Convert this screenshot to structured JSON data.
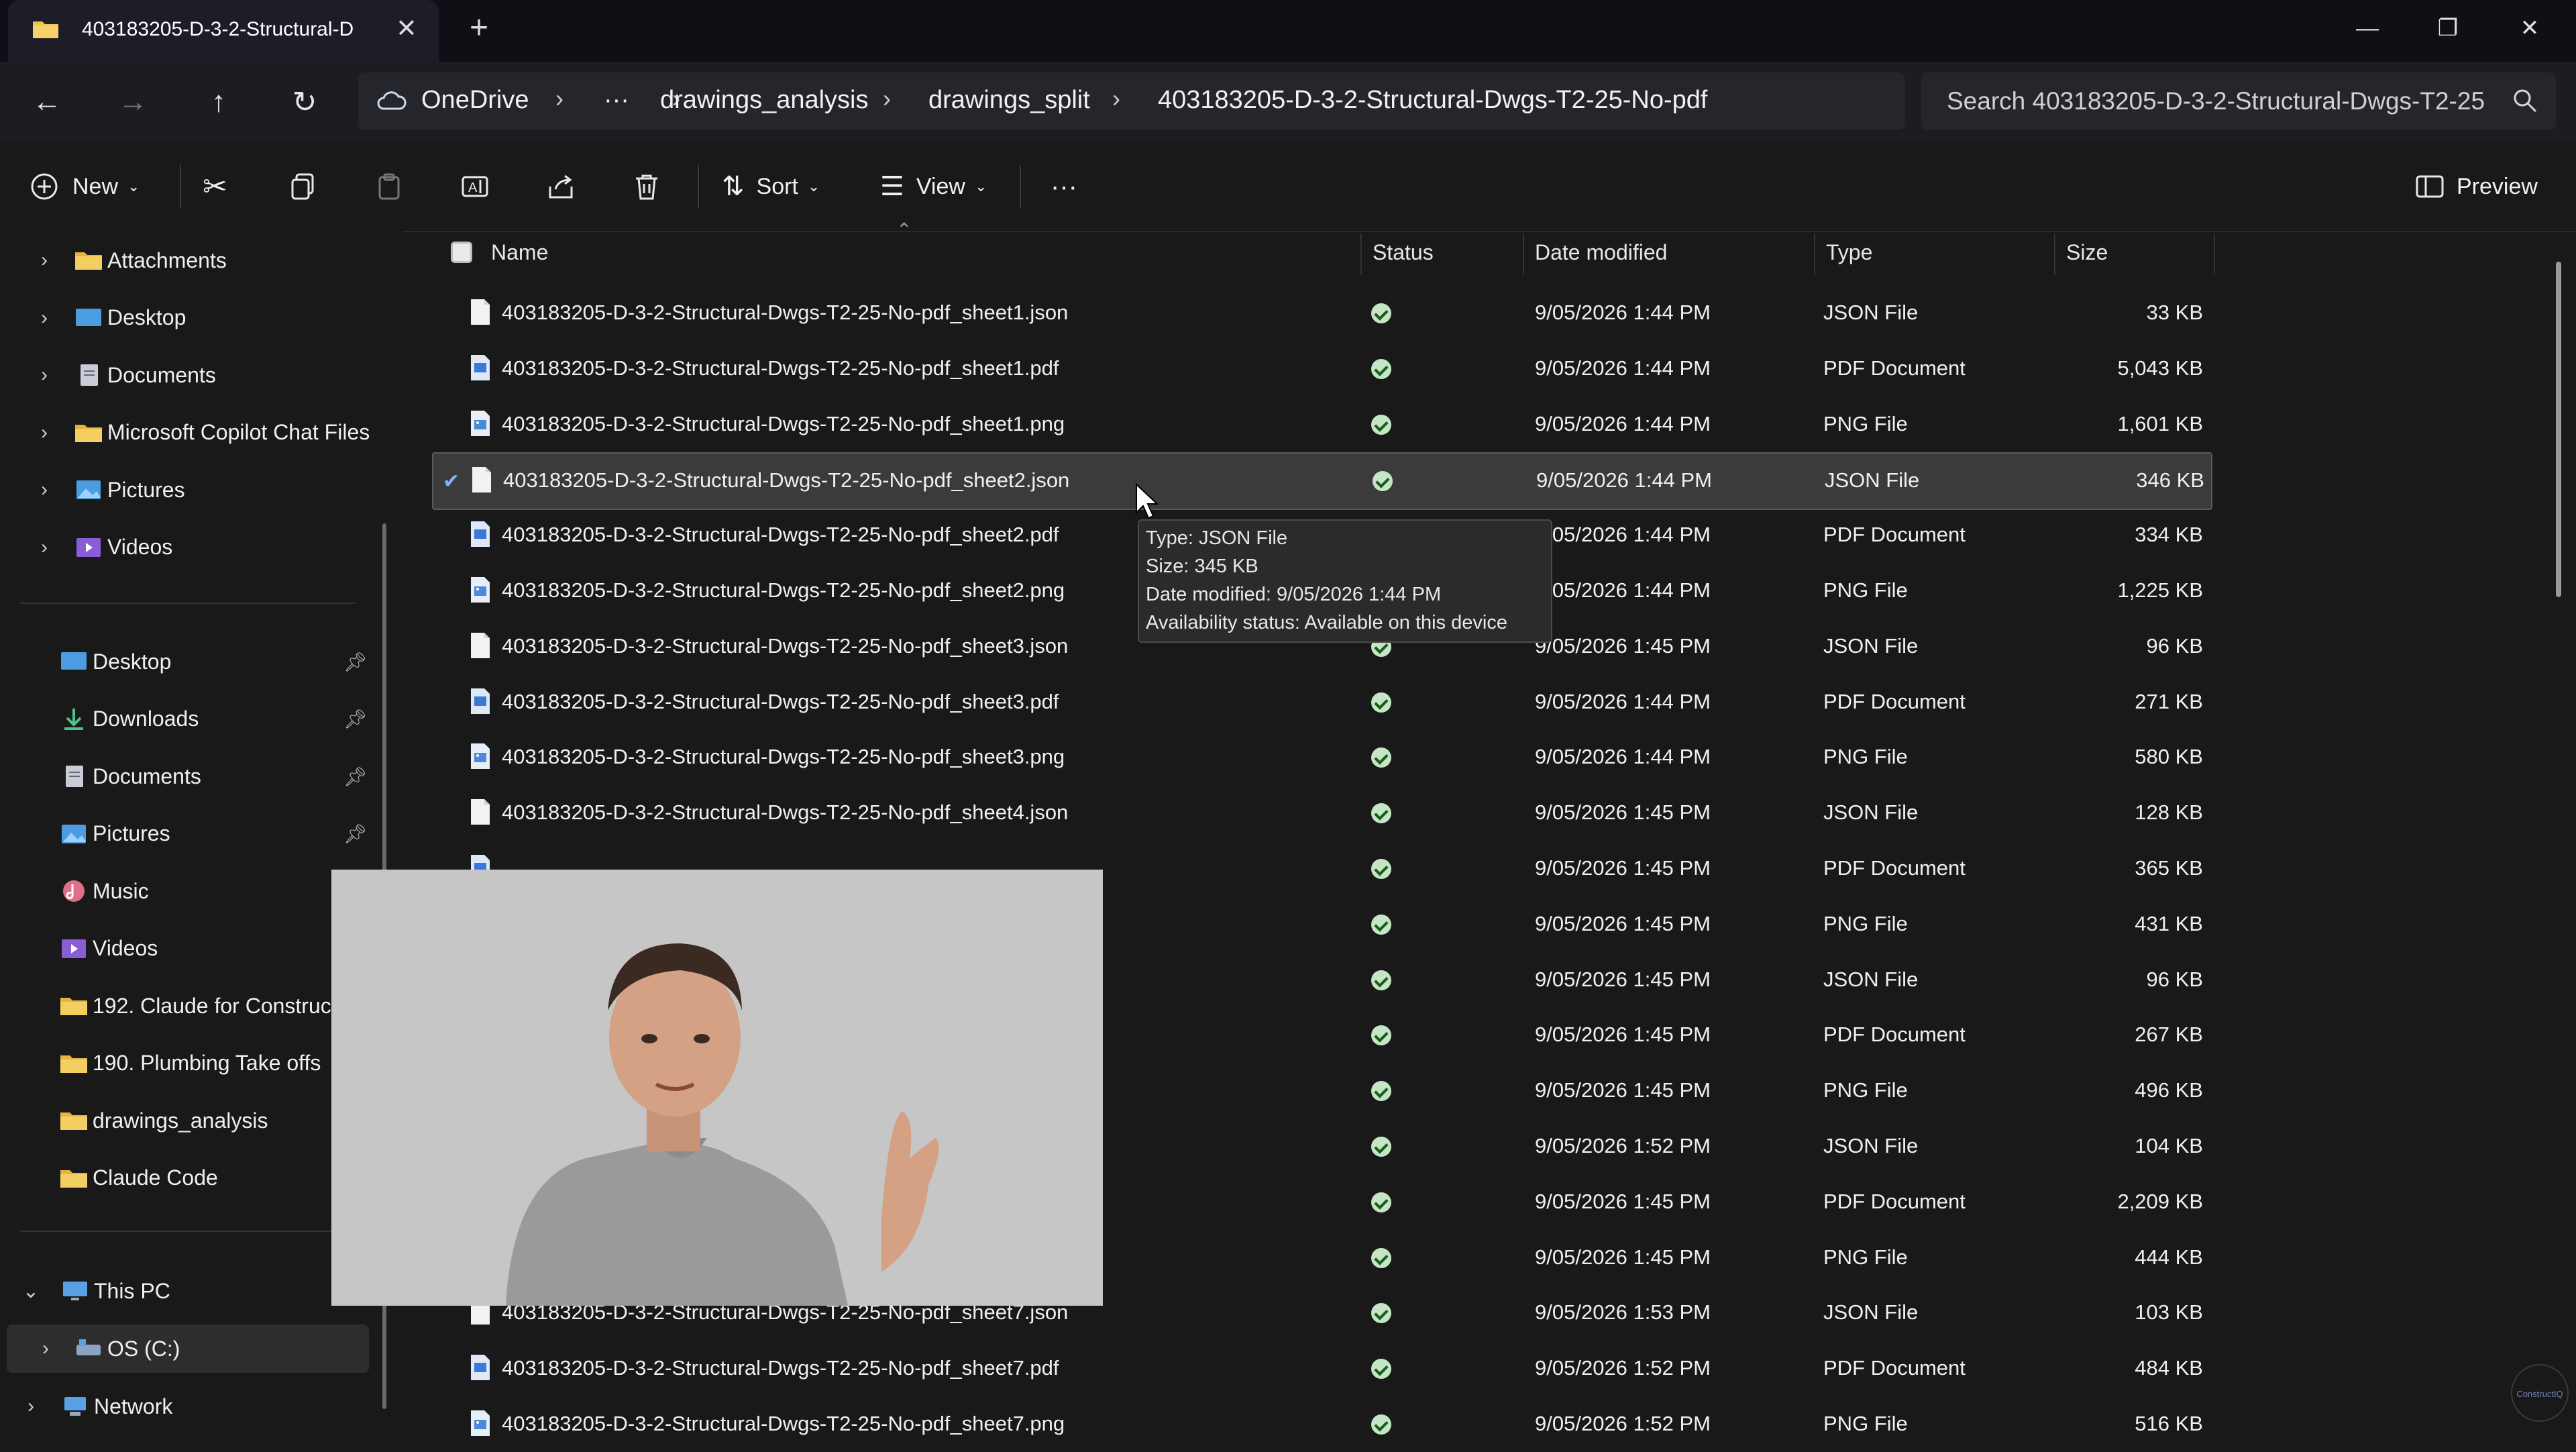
{
  "window": {
    "tab_title": "403183205-D-3-2-Structural-D",
    "tab_close": "✕",
    "new_tab": "+",
    "minimize": "—",
    "maximize": "❐",
    "close": "✕"
  },
  "address": {
    "breadcrumb": [
      "OneDrive",
      "···",
      "drawings_analysis",
      "drawings_split",
      "403183205-D-3-2-Structural-Dwgs-T2-25-No-pdf"
    ],
    "search_placeholder": "Search 403183205-D-3-2-Structural-Dwgs-T2-25"
  },
  "toolbar": {
    "new_label": "New",
    "sort_label": "Sort",
    "view_label": "View",
    "more_label": "···",
    "preview_label": "Preview"
  },
  "sidebar": {
    "top_items": [
      "Attachments",
      "Desktop",
      "Documents",
      "Microsoft Copilot Chat Files",
      "Pictures",
      "Videos"
    ],
    "quick_access": [
      "Desktop",
      "Downloads",
      "Documents",
      "Pictures",
      "Music",
      "Videos",
      "192. Claude for Construc",
      "190. Plumbing Take offs",
      "drawings_analysis",
      "Claude Code"
    ],
    "this_pc": "This PC",
    "os_drive": "OS (C:)",
    "network": "Network"
  },
  "columns": {
    "name": "Name",
    "status": "Status",
    "date": "Date modified",
    "type": "Type",
    "size": "Size"
  },
  "files": [
    {
      "name": "403183205-D-3-2-Structural-Dwgs-T2-25-No-pdf_sheet1.json",
      "date": "9/05/2026 1:44 PM",
      "type": "JSON File",
      "size": "33 KB",
      "kind": "json"
    },
    {
      "name": "403183205-D-3-2-Structural-Dwgs-T2-25-No-pdf_sheet1.pdf",
      "date": "9/05/2026 1:44 PM",
      "type": "PDF Document",
      "size": "5,043 KB",
      "kind": "pdf"
    },
    {
      "name": "403183205-D-3-2-Structural-Dwgs-T2-25-No-pdf_sheet1.png",
      "date": "9/05/2026 1:44 PM",
      "type": "PNG File",
      "size": "1,601 KB",
      "kind": "png"
    },
    {
      "name": "403183205-D-3-2-Structural-Dwgs-T2-25-No-pdf_sheet2.json",
      "date": "9/05/2026 1:44 PM",
      "type": "JSON File",
      "size": "346 KB",
      "kind": "json"
    },
    {
      "name": "403183205-D-3-2-Structural-Dwgs-T2-25-No-pdf_sheet2.pdf",
      "date": "9/05/2026 1:44 PM",
      "type": "PDF Document",
      "size": "334 KB",
      "kind": "pdf"
    },
    {
      "name": "403183205-D-3-2-Structural-Dwgs-T2-25-No-pdf_sheet2.png",
      "date": "9/05/2026 1:44 PM",
      "type": "PNG File",
      "size": "1,225 KB",
      "kind": "png"
    },
    {
      "name": "403183205-D-3-2-Structural-Dwgs-T2-25-No-pdf_sheet3.json",
      "date": "9/05/2026 1:45 PM",
      "type": "JSON File",
      "size": "96 KB",
      "kind": "json"
    },
    {
      "name": "403183205-D-3-2-Structural-Dwgs-T2-25-No-pdf_sheet3.pdf",
      "date": "9/05/2026 1:44 PM",
      "type": "PDF Document",
      "size": "271 KB",
      "kind": "pdf"
    },
    {
      "name": "403183205-D-3-2-Structural-Dwgs-T2-25-No-pdf_sheet3.png",
      "date": "9/05/2026 1:44 PM",
      "type": "PNG File",
      "size": "580 KB",
      "kind": "png"
    },
    {
      "name": "403183205-D-3-2-Structural-Dwgs-T2-25-No-pdf_sheet4.json",
      "date": "9/05/2026 1:45 PM",
      "type": "JSON File",
      "size": "128 KB",
      "kind": "json"
    },
    {
      "name": "",
      "date": "9/05/2026 1:45 PM",
      "type": "PDF Document",
      "size": "365 KB",
      "kind": "pdf"
    },
    {
      "name": "",
      "date": "9/05/2026 1:45 PM",
      "type": "PNG File",
      "size": "431 KB",
      "kind": "png"
    },
    {
      "name": "",
      "date": "9/05/2026 1:45 PM",
      "type": "JSON File",
      "size": "96 KB",
      "kind": "json"
    },
    {
      "name": "",
      "date": "9/05/2026 1:45 PM",
      "type": "PDF Document",
      "size": "267 KB",
      "kind": "pdf"
    },
    {
      "name": "",
      "date": "9/05/2026 1:45 PM",
      "type": "PNG File",
      "size": "496 KB",
      "kind": "png"
    },
    {
      "name": "",
      "date": "9/05/2026 1:52 PM",
      "type": "JSON File",
      "size": "104 KB",
      "kind": "json"
    },
    {
      "name": "",
      "date": "9/05/2026 1:45 PM",
      "type": "PDF Document",
      "size": "2,209 KB",
      "kind": "pdf"
    },
    {
      "name": "",
      "date": "9/05/2026 1:45 PM",
      "type": "PNG File",
      "size": "444 KB",
      "kind": "png"
    },
    {
      "name": "403183205-D-3-2-Structural-Dwgs-T2-25-No-pdf_sheet7.json",
      "date": "9/05/2026 1:53 PM",
      "type": "JSON File",
      "size": "103 KB",
      "kind": "json"
    },
    {
      "name": "403183205-D-3-2-Structural-Dwgs-T2-25-No-pdf_sheet7.pdf",
      "date": "9/05/2026 1:52 PM",
      "type": "PDF Document",
      "size": "484 KB",
      "kind": "pdf"
    },
    {
      "name": "403183205-D-3-2-Structural-Dwgs-T2-25-No-pdf_sheet7.png",
      "date": "9/05/2026 1:52 PM",
      "type": "PNG File",
      "size": "516 KB",
      "kind": "png"
    }
  ],
  "selected_index": 3,
  "tooltip": [
    "Type: JSON File",
    "Size: 345 KB",
    "Date modified: 9/05/2026 1:44 PM",
    "Availability status: Available on this device"
  ],
  "watermark": "ConstructIQ",
  "colors": {
    "background": "#191919",
    "selected_row": "#3b3b3b",
    "status_ok": "#c4e6c4",
    "folder": "#f1c34a",
    "accent": "#4ea1ff"
  }
}
